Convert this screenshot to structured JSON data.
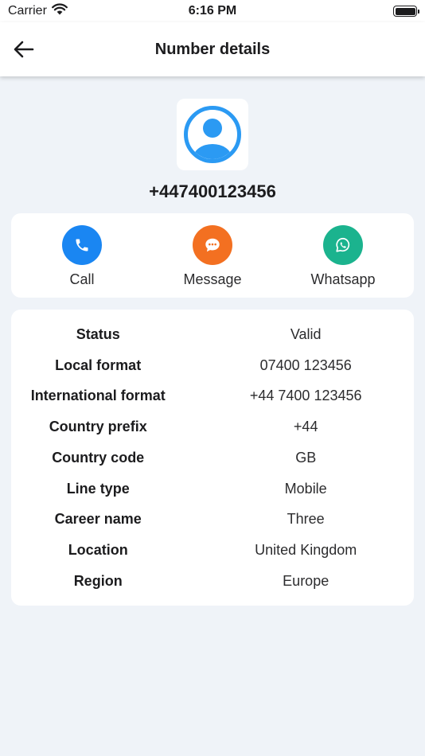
{
  "status_bar": {
    "carrier": "Carrier",
    "time": "6:16 PM"
  },
  "nav": {
    "title": "Number details"
  },
  "phone_number": "+447400123456",
  "actions": [
    {
      "label": "Call",
      "color": "#1a86f2",
      "icon": "phone-icon"
    },
    {
      "label": "Message",
      "color": "#f37021",
      "icon": "message-icon"
    },
    {
      "label": "Whatsapp",
      "color": "#1bb38e",
      "icon": "whatsapp-icon"
    }
  ],
  "details": [
    {
      "label": "Status",
      "value": "Valid"
    },
    {
      "label": "Local format",
      "value": "07400 123456"
    },
    {
      "label": "International format",
      "value": "+44 7400 123456"
    },
    {
      "label": "Country prefix",
      "value": "+44"
    },
    {
      "label": "Country code",
      "value": "GB"
    },
    {
      "label": "Line type",
      "value": "Mobile"
    },
    {
      "label": "Career name",
      "value": "Three"
    },
    {
      "label": "Location",
      "value": "United Kingdom"
    },
    {
      "label": "Region",
      "value": "Europe"
    }
  ],
  "colors": {
    "background": "#eff3f8",
    "avatar": "#2b9af3"
  }
}
